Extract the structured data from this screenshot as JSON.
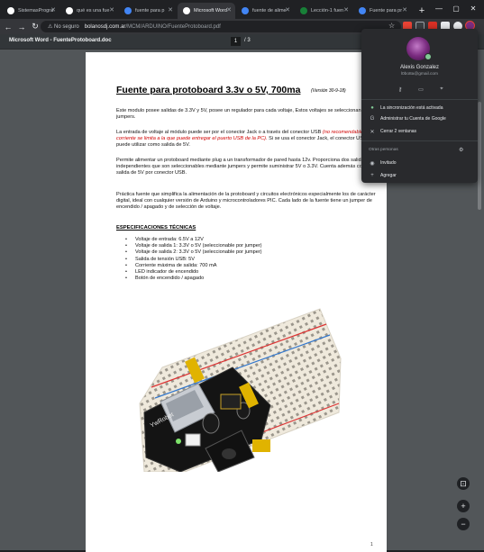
{
  "tabs": [
    {
      "title": "SistemasProgra",
      "icon": "github-icon",
      "color": "#ffffff",
      "active": false
    },
    {
      "title": "qué es una fue",
      "icon": "github-icon",
      "color": "#ffffff",
      "active": false
    },
    {
      "title": "fuente para p",
      "icon": "site-icon",
      "color": "#4285f4",
      "active": false
    },
    {
      "title": "Microsoft Word",
      "icon": "github-icon",
      "color": "#ffffff",
      "active": true
    },
    {
      "title": "fuente de alime",
      "icon": "site-icon",
      "color": "#4285f4",
      "active": false
    },
    {
      "title": "Lección-1 fuen",
      "icon": "site-icon",
      "color": "#188038",
      "active": false
    },
    {
      "title": "Fuente para pr",
      "icon": "site-icon",
      "color": "#4285f4",
      "active": false
    }
  ],
  "omnibox": {
    "security": "No seguro",
    "host": "bolanosdj.com.ar",
    "path": "/MCM/ARDUINO/FuenteProtoboard.pdf"
  },
  "pdf_toolbar": {
    "title": "Microsoft Word - FuenteProtoboard.doc",
    "page": "1",
    "total": "/ 3"
  },
  "document": {
    "title": "Fuente para protoboard 3.3v o 5V, 700ma",
    "version": "(Versión 30-9-18)",
    "para1": "Este modulo posee salidas de 3.3V y 5V, posee un regulador para cada voltaje, Estos voltajes se seleccionan con jumpers.",
    "para2_a": "La entrada de voltaje al módulo puede ser por el conector Jack o a través del conector USB ",
    "para2_warn": "(no recomendable, la corriente se limita a la que puede entregar el puerto USB de la PC).",
    "para2_b": " Si se usa el conector Jack, el conector USB se puede utilizar como salida de 5V.",
    "para3": "Permite alimentar un protoboard mediante plug a un transformador de pared hasta 12v. Proporciona dos salidas independientes que son seleccionables mediante jumpers y permite suministrar 5V o 3.3V. Cuenta además con salida de 5V por conector USB.",
    "para4": "Práctica fuente que simplifica la alimentación de la protoboard y circuitos electrónicos especialmente los de carácter digital, ideal con cualquier versión de Arduino y microcontroladores PIC. Cada lado de la fuente tiene un jumper de encendido / apagado y de selección de voltaje.",
    "spec_title": "ESPECIFICACIONES TÉCNICAS",
    "specs": [
      "Voltaje de entrada: 6.5V a 12V",
      "Voltaje de salida 1: 3.3V o 5V (seleccionable por jumper)",
      "Voltaje de salida 2: 3.3V o 5V (seleccionable por jumper)",
      "Salida de tensión USB: 5V",
      "Corriente máxima de salida: 700 mA",
      "LED indicador de encendido",
      "Botón de encendido / apagado"
    ],
    "page_number": "1",
    "board_label": "YwRobot"
  },
  "profile": {
    "name": "Alexis Gonzalez",
    "email": "l0bo8a@gmail.com",
    "sync": "La sincronización está activada",
    "manage": "Administrar tu Cuenta de Google",
    "close_windows": "Cerrar 2 ventanas",
    "others_label": "Otras personas",
    "guest": "Invitado",
    "add": "Agregar"
  }
}
